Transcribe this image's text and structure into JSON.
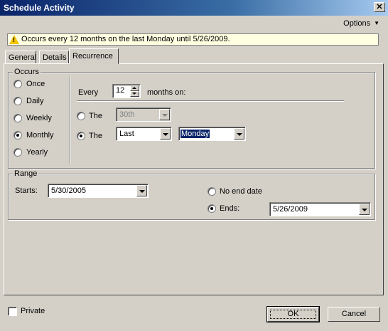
{
  "window": {
    "title": "Schedule Activity",
    "close_label": "✕"
  },
  "options_label": "Options",
  "info": {
    "icon": "warning-icon",
    "message": "Occurs every 12 months on the last Monday until 5/26/2009."
  },
  "tabs": [
    {
      "label": "General"
    },
    {
      "label": "Details"
    },
    {
      "label": "Recurrence"
    }
  ],
  "active_tab": "Recurrence",
  "occurs": {
    "legend": "Occurs",
    "options": [
      {
        "label": "Once",
        "checked": false
      },
      {
        "label": "Daily",
        "checked": false
      },
      {
        "label": "Weekly",
        "checked": false
      },
      {
        "label": "Monthly",
        "checked": true
      },
      {
        "label": "Yearly",
        "checked": false
      }
    ],
    "every_label": "Every",
    "every_value": "12",
    "months_on_label": "months on:",
    "the_day": {
      "label": "The",
      "value": "30th",
      "enabled": false
    },
    "the_weekday": {
      "label": "The",
      "ordinal": "Last",
      "weekday": "Monday",
      "checked": true
    }
  },
  "range": {
    "legend": "Range",
    "starts_label": "Starts:",
    "starts_value": "5/30/2005",
    "no_end_label": "No end date",
    "ends_label": "Ends:",
    "ends_value": "5/26/2009",
    "ends_checked": true
  },
  "private_label": "Private",
  "private_checked": false,
  "buttons": {
    "ok": "OK",
    "cancel": "Cancel"
  }
}
